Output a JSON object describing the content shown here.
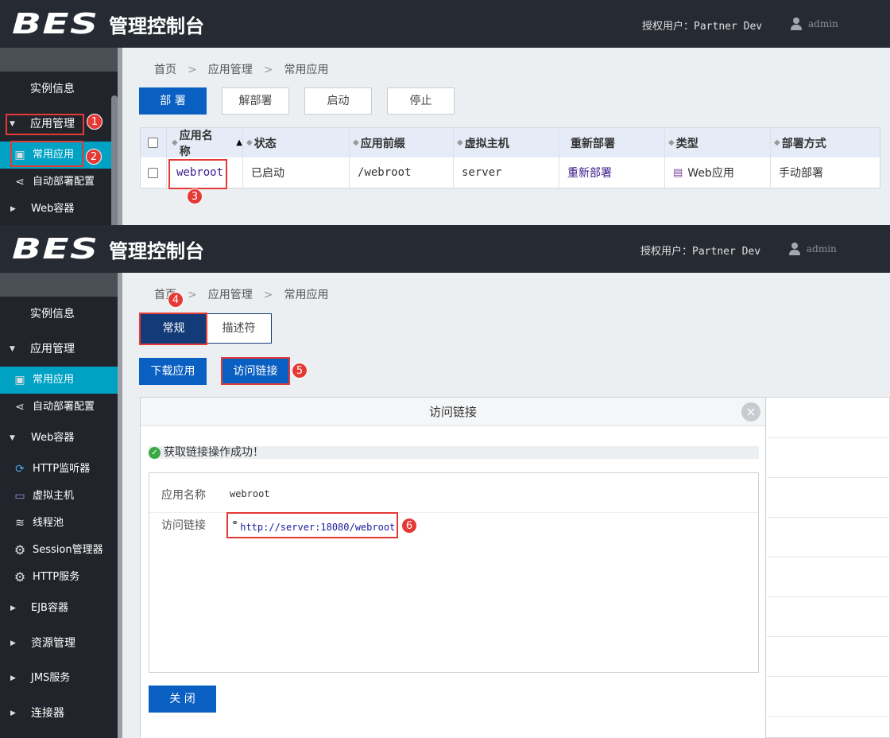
{
  "header": {
    "logo_text": "BES",
    "title": "管理控制台",
    "user_label": "授权用户：",
    "user_value": "Partner Dev",
    "admin": "admin"
  },
  "breadcrumb": [
    "首页",
    "应用管理",
    "常用应用"
  ],
  "screen1": {
    "sidebar": {
      "instance_info": "实例信息",
      "app_mgmt": "应用管理",
      "common_apps": "常用应用",
      "auto_deploy": "自动部署配置",
      "web_container": "Web容器"
    },
    "buttons": {
      "deploy": "部 署",
      "undeploy": "解部署",
      "start": "启动",
      "stop": "停止"
    },
    "table": {
      "headers": [
        "应用名称",
        "状态",
        "应用前缀",
        "虚拟主机",
        "重新部署",
        "类型",
        "部署方式"
      ],
      "row": {
        "name": "webroot",
        "status": "已启动",
        "prefix": "/webroot",
        "vhost": "server",
        "redeploy": "重新部署",
        "type": "Web应用",
        "deploy_mode": "手动部署"
      }
    }
  },
  "screen2": {
    "sidebar": {
      "instance_info": "实例信息",
      "app_mgmt": "应用管理",
      "common_apps": "常用应用",
      "auto_deploy": "自动部署配置",
      "web_container": "Web容器",
      "http_listener": "HTTP监听器",
      "virtual_host": "虚拟主机",
      "thread_pool": "线程池",
      "session_mgr": "Session管理器",
      "http_service": "HTTP服务",
      "ejb_container": "EJB容器",
      "resource_mgmt": "资源管理",
      "jms_service": "JMS服务",
      "connector": "连接器"
    },
    "tabs": {
      "general": "常规",
      "descriptor": "描述符"
    },
    "buttons": {
      "download": "下载应用",
      "access_link": "访问链接"
    },
    "dialog": {
      "title": "访问链接",
      "success": "获取链接操作成功！",
      "app_name_label": "应用名称",
      "app_name_value": "webroot",
      "link_label": "访问链接",
      "link_value": "http://server:18080/webroot",
      "close": "关 闭"
    }
  },
  "badges": [
    "1",
    "2",
    "3",
    "4",
    "5",
    "6"
  ],
  "colors": {
    "header_bg": "#262b33",
    "sidebar_bg": "#21252b",
    "active": "#00a2c4",
    "primary": "#0a5fc2",
    "highlight": "#e53935"
  }
}
